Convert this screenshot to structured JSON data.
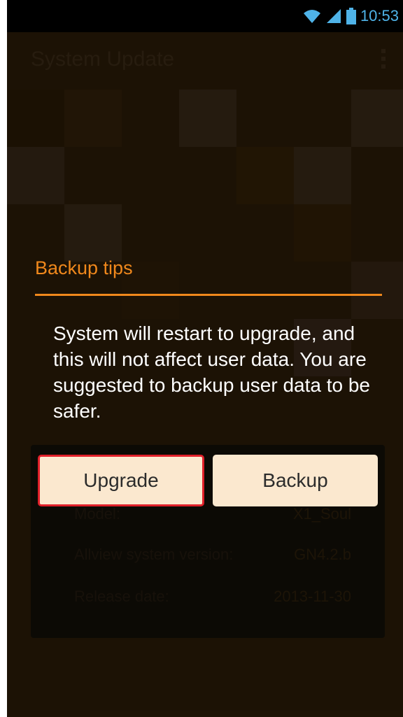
{
  "status_bar": {
    "time": "10:53"
  },
  "app": {
    "title": "System Update"
  },
  "info": {
    "model_label": "Model:",
    "model_value": "X1_Soul",
    "version_label": "Allview system version:",
    "version_value": "GN4.2.b",
    "release_label": "Release date:",
    "release_value": "2013-11-30"
  },
  "dialog": {
    "title": "Backup tips",
    "message": "System will restart to upgrade, and this will not affect user data. You are suggested to backup user data to be safer.",
    "upgrade_label": "Upgrade",
    "backup_label": "Backup"
  },
  "colors": {
    "accent": "#f0881c",
    "highlight": "#e0202a",
    "button_bg": "#fbe8cf"
  }
}
